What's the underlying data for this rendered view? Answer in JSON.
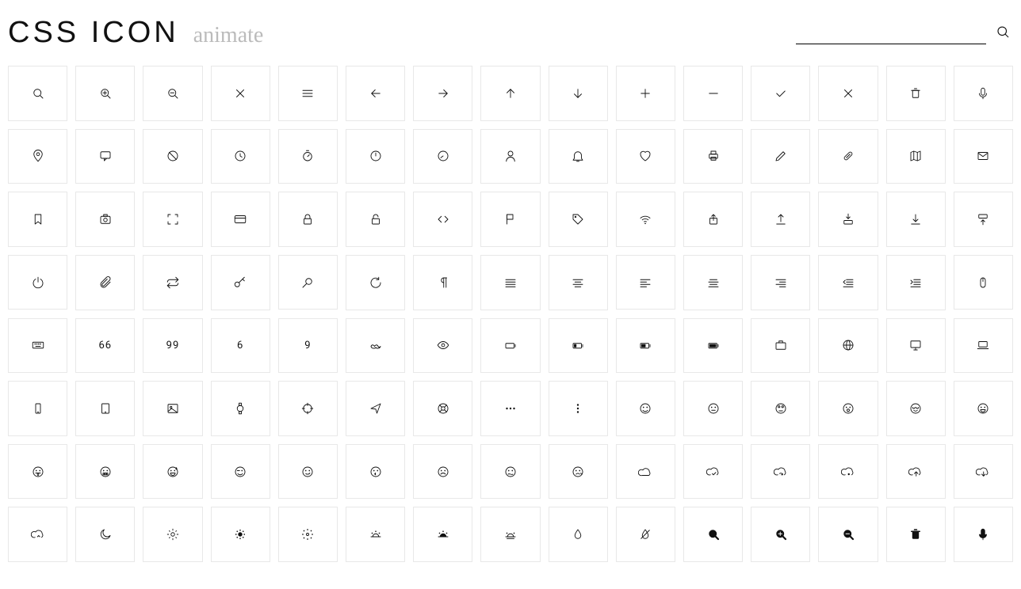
{
  "header": {
    "title": "CSS ICON",
    "subtitle": "animate",
    "search_placeholder": ""
  },
  "icons": [
    {
      "name": "search-icon"
    },
    {
      "name": "zoom-in-icon"
    },
    {
      "name": "zoom-out-icon"
    },
    {
      "name": "close-icon"
    },
    {
      "name": "menu-icon"
    },
    {
      "name": "arrow-left-icon"
    },
    {
      "name": "arrow-right-icon"
    },
    {
      "name": "arrow-up-icon"
    },
    {
      "name": "arrow-down-icon"
    },
    {
      "name": "plus-icon"
    },
    {
      "name": "minus-icon"
    },
    {
      "name": "check-icon"
    },
    {
      "name": "x-icon"
    },
    {
      "name": "trash-icon"
    },
    {
      "name": "mic-icon"
    },
    {
      "name": "location-icon"
    },
    {
      "name": "comment-icon"
    },
    {
      "name": "ban-icon"
    },
    {
      "name": "clock-icon"
    },
    {
      "name": "stopwatch-icon"
    },
    {
      "name": "timer-icon"
    },
    {
      "name": "dashboard-icon"
    },
    {
      "name": "user-icon"
    },
    {
      "name": "bell-icon"
    },
    {
      "name": "heart-icon"
    },
    {
      "name": "printer-icon"
    },
    {
      "name": "pencil-icon"
    },
    {
      "name": "pill-icon"
    },
    {
      "name": "map-icon"
    },
    {
      "name": "mail-icon"
    },
    {
      "name": "bookmark-icon"
    },
    {
      "name": "camera-icon"
    },
    {
      "name": "fullscreen-icon"
    },
    {
      "name": "credit-card-icon"
    },
    {
      "name": "lock-icon"
    },
    {
      "name": "unlock-icon"
    },
    {
      "name": "code-icon"
    },
    {
      "name": "flag-icon"
    },
    {
      "name": "tag-icon"
    },
    {
      "name": "wifi-icon"
    },
    {
      "name": "share-icon"
    },
    {
      "name": "upload-icon"
    },
    {
      "name": "download-in-icon"
    },
    {
      "name": "download-icon"
    },
    {
      "name": "open-up-icon"
    },
    {
      "name": "power-icon"
    },
    {
      "name": "attachment-icon"
    },
    {
      "name": "repeat-icon"
    },
    {
      "name": "key-icon"
    },
    {
      "name": "magnifier-icon"
    },
    {
      "name": "refresh-icon"
    },
    {
      "name": "paragraph-icon"
    },
    {
      "name": "align-justify-icon"
    },
    {
      "name": "align-center-icon"
    },
    {
      "name": "align-left-icon"
    },
    {
      "name": "align-center-alt-icon"
    },
    {
      "name": "align-right-icon"
    },
    {
      "name": "indent-left-icon"
    },
    {
      "name": "indent-right-icon"
    },
    {
      "name": "mouse-icon"
    },
    {
      "name": "keyboard-icon"
    },
    {
      "name": "sixty-six-icon",
      "text": "66"
    },
    {
      "name": "ninety-nine-icon",
      "text": "99"
    },
    {
      "name": "six-icon",
      "text": "6"
    },
    {
      "name": "nine-icon",
      "text": "9"
    },
    {
      "name": "moustache-icon"
    },
    {
      "name": "eye-icon"
    },
    {
      "name": "battery-empty-icon"
    },
    {
      "name": "battery-low-icon"
    },
    {
      "name": "battery-half-icon"
    },
    {
      "name": "battery-full-icon"
    },
    {
      "name": "briefcase-icon"
    },
    {
      "name": "globe-icon"
    },
    {
      "name": "monitor-icon"
    },
    {
      "name": "laptop-icon"
    },
    {
      "name": "phone-icon"
    },
    {
      "name": "tablet-icon"
    },
    {
      "name": "image-icon"
    },
    {
      "name": "watch-icon"
    },
    {
      "name": "crosshair-icon"
    },
    {
      "name": "navigation-icon"
    },
    {
      "name": "lifebuoy-icon"
    },
    {
      "name": "dots-horizontal-icon"
    },
    {
      "name": "dots-vertical-icon"
    },
    {
      "name": "smile-icon"
    },
    {
      "name": "neutral-face-icon"
    },
    {
      "name": "rolling-eyes-icon"
    },
    {
      "name": "surprised-icon"
    },
    {
      "name": "relieved-icon"
    },
    {
      "name": "grin-icon"
    },
    {
      "name": "tongue-out-icon"
    },
    {
      "name": "grimace-icon"
    },
    {
      "name": "sweat-smile-icon"
    },
    {
      "name": "wink-icon"
    },
    {
      "name": "smirk-icon"
    },
    {
      "name": "kiss-icon"
    },
    {
      "name": "frown-icon"
    },
    {
      "name": "confused-icon"
    },
    {
      "name": "sad-icon"
    },
    {
      "name": "cloud-icon"
    },
    {
      "name": "cloud-check-icon"
    },
    {
      "name": "cloud-sync-icon"
    },
    {
      "name": "cloud-dot-icon"
    },
    {
      "name": "cloud-upload-icon"
    },
    {
      "name": "cloud-download-icon"
    },
    {
      "name": "cloud-up-icon"
    },
    {
      "name": "moon-icon"
    },
    {
      "name": "sun-icon"
    },
    {
      "name": "sun-dim-icon"
    },
    {
      "name": "sun-bright-icon"
    },
    {
      "name": "sunrise-icon"
    },
    {
      "name": "sunset-icon"
    },
    {
      "name": "dusk-icon"
    },
    {
      "name": "droplet-icon"
    },
    {
      "name": "no-droplet-icon"
    },
    {
      "name": "search-filled-icon",
      "filled": true
    },
    {
      "name": "zoom-in-filled-icon",
      "filled": true
    },
    {
      "name": "zoom-out-filled-icon",
      "filled": true
    },
    {
      "name": "trash-filled-icon",
      "filled": true
    },
    {
      "name": "mic-filled-icon",
      "filled": true
    }
  ]
}
